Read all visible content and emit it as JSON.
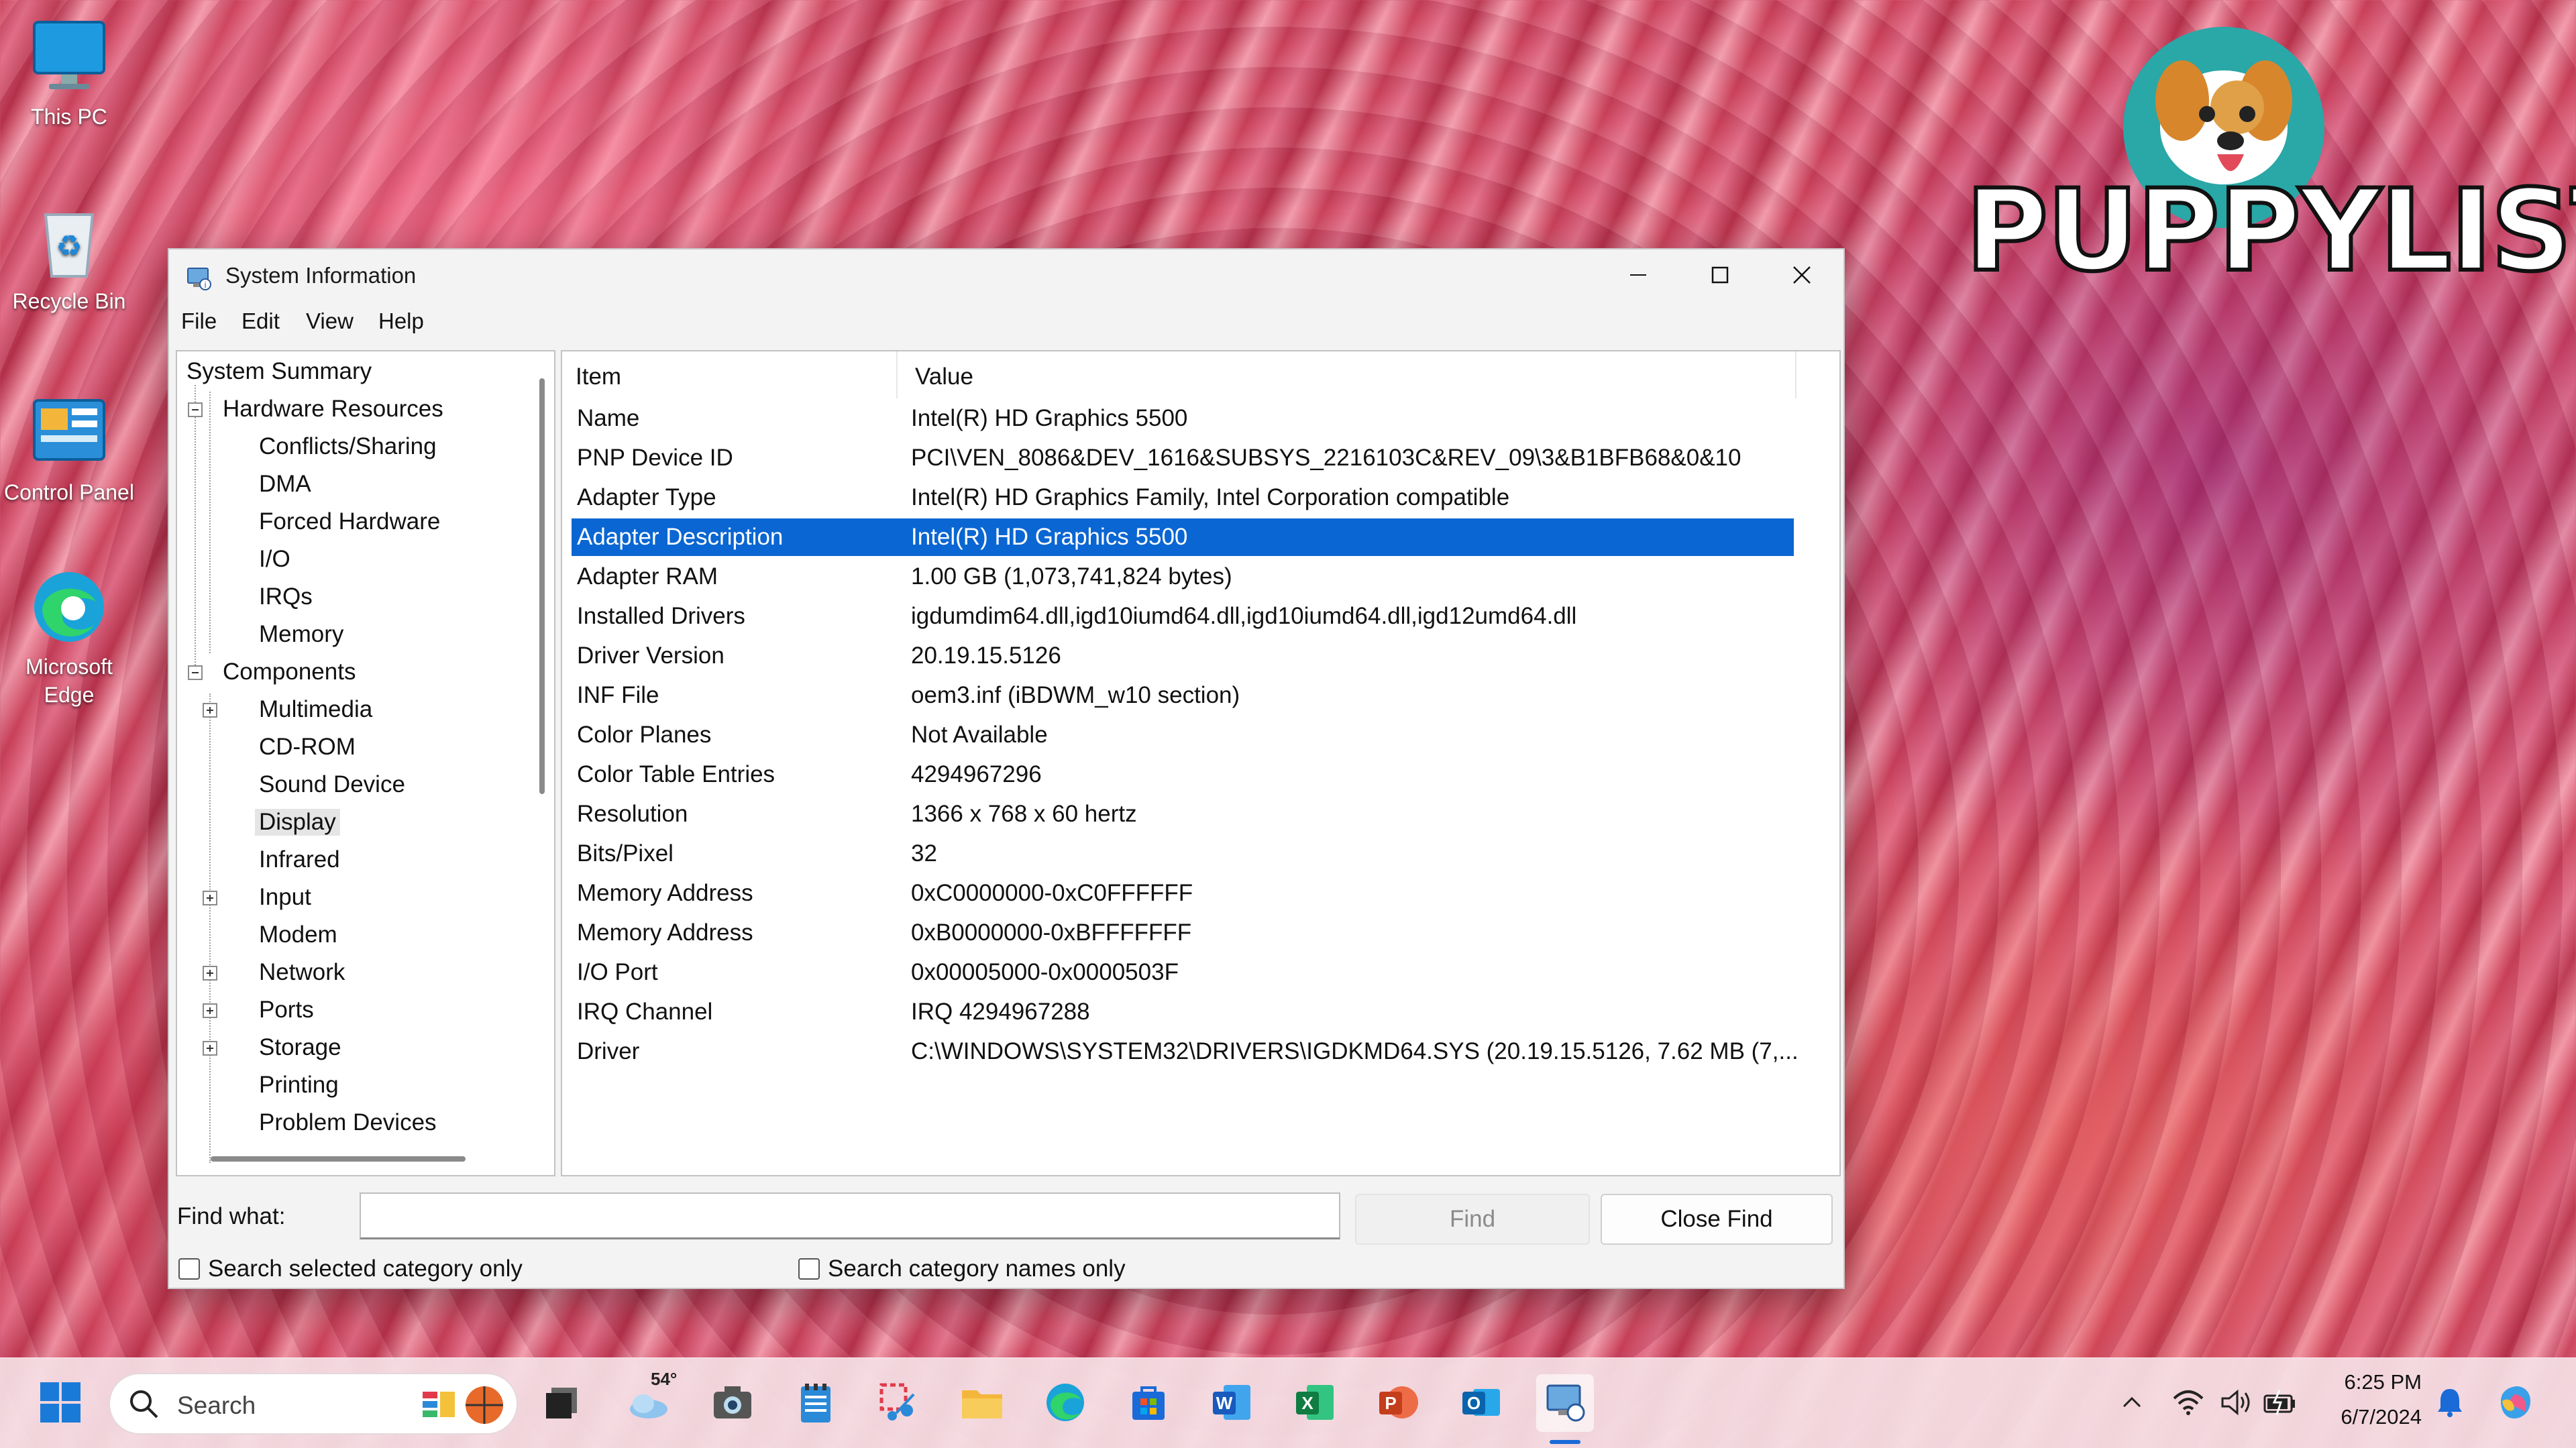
{
  "desktop": {
    "icons": [
      {
        "label": "This PC",
        "icon": "monitor-icon"
      },
      {
        "label": "Recycle Bin",
        "icon": "recycle-bin-icon"
      },
      {
        "label": "Control Panel",
        "icon": "control-panel-icon"
      },
      {
        "label": "Microsoft Edge",
        "icon": "edge-icon"
      }
    ],
    "logo_text": "PUPPYLIST"
  },
  "window": {
    "title": "System Information",
    "controls": {
      "minimize": "minimize-icon",
      "maximize": "maximize-icon",
      "close": "close-icon"
    },
    "menu": [
      "File",
      "Edit",
      "View",
      "Help"
    ]
  },
  "tree": {
    "items": [
      {
        "label": "System Summary"
      },
      {
        "label": "Hardware Resources"
      },
      {
        "label": "Conflicts/Sharing"
      },
      {
        "label": "DMA"
      },
      {
        "label": "Forced Hardware"
      },
      {
        "label": "I/O"
      },
      {
        "label": "IRQs"
      },
      {
        "label": "Memory"
      },
      {
        "label": "Components"
      },
      {
        "label": "Multimedia"
      },
      {
        "label": "CD-ROM"
      },
      {
        "label": "Sound Device"
      },
      {
        "label": "Display"
      },
      {
        "label": "Infrared"
      },
      {
        "label": "Input"
      },
      {
        "label": "Modem"
      },
      {
        "label": "Network"
      },
      {
        "label": "Ports"
      },
      {
        "label": "Storage"
      },
      {
        "label": "Printing"
      },
      {
        "label": "Problem Devices"
      }
    ],
    "selected": "Display"
  },
  "details": {
    "headers": {
      "item": "Item",
      "value": "Value"
    },
    "rows": [
      {
        "item": "Name",
        "value": "Intel(R) HD Graphics 5500"
      },
      {
        "item": "PNP Device ID",
        "value": "PCI\\VEN_8086&DEV_1616&SUBSYS_2216103C&REV_09\\3&B1BFB68&0&10"
      },
      {
        "item": "Adapter Type",
        "value": "Intel(R) HD Graphics Family, Intel Corporation compatible"
      },
      {
        "item": "Adapter Description",
        "value": "Intel(R) HD Graphics 5500"
      },
      {
        "item": "Adapter RAM",
        "value": "1.00 GB (1,073,741,824 bytes)"
      },
      {
        "item": "Installed Drivers",
        "value": "igdumdim64.dll,igd10iumd64.dll,igd10iumd64.dll,igd12umd64.dll"
      },
      {
        "item": "Driver Version",
        "value": "20.19.15.5126"
      },
      {
        "item": "INF File",
        "value": "oem3.inf (iBDWM_w10 section)"
      },
      {
        "item": "Color Planes",
        "value": "Not Available"
      },
      {
        "item": "Color Table Entries",
        "value": "4294967296"
      },
      {
        "item": "Resolution",
        "value": "1366 x 768 x 60 hertz"
      },
      {
        "item": "Bits/Pixel",
        "value": "32"
      },
      {
        "item": "Memory Address",
        "value": "0xC0000000-0xC0FFFFFF"
      },
      {
        "item": "Memory Address",
        "value": "0xB0000000-0xBFFFFFFF"
      },
      {
        "item": "I/O Port",
        "value": "0x00005000-0x0000503F"
      },
      {
        "item": "IRQ Channel",
        "value": "IRQ 4294967288"
      },
      {
        "item": "Driver",
        "value": "C:\\WINDOWS\\SYSTEM32\\DRIVERS\\IGDKMD64.SYS (20.19.15.5126, 7.62 MB (7,..."
      }
    ],
    "selected_row": "Adapter Description",
    "selection_color": "#0a66d2"
  },
  "find": {
    "label": "Find what:",
    "value": "",
    "find_button": "Find",
    "close_find_button": "Close Find",
    "checkbox_selected_category": "Search selected category only",
    "checkbox_category_names": "Search category names only"
  },
  "taskbar": {
    "search_placeholder": "Search",
    "weather_temp": "54°",
    "time": "6:25 PM",
    "date": "6/7/2024",
    "apps": [
      "start-icon",
      "task-view-icon",
      "weather-icon",
      "camera-icon",
      "notepad-icon",
      "snipping-tool-icon",
      "file-explorer-icon",
      "edge-icon",
      "store-icon",
      "word-icon",
      "excel-icon",
      "powerpoint-icon",
      "outlook-icon",
      "system-information-icon"
    ],
    "tray": [
      "chevron-up-icon",
      "wifi-icon",
      "volume-icon",
      "battery-icon",
      "notification-bell-icon",
      "copilot-icon"
    ]
  }
}
